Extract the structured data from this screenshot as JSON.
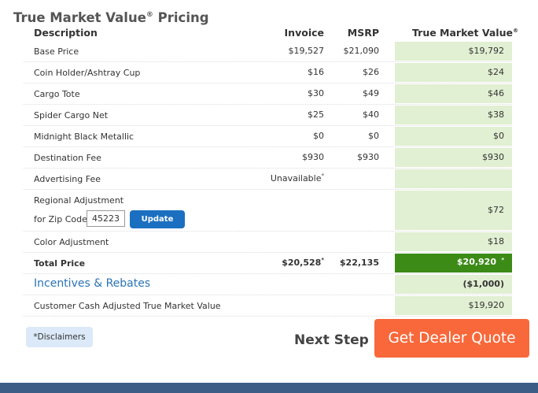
{
  "title": "True Market Value",
  "title_mark": "®",
  "columns": {
    "description": "Description",
    "invoice": "Invoice",
    "msrp": "MSRP",
    "tmv": "True Market Value",
    "tmv_mark": "®"
  },
  "rows": [
    {
      "label": "Base Price",
      "invoice": "$19,527",
      "msrp": "$21,090",
      "tmv": "$19,792"
    },
    {
      "label": "Coin Holder/Ashtray Cup",
      "invoice": "$16",
      "msrp": "$26",
      "tmv": "$24"
    },
    {
      "label": "Cargo Tote",
      "invoice": "$30",
      "msrp": "$49",
      "tmv": "$46"
    },
    {
      "label": "Spider Cargo Net",
      "invoice": "$25",
      "msrp": "$40",
      "tmv": "$38"
    },
    {
      "label": "Midnight Black Metallic",
      "invoice": "$0",
      "msrp": "$0",
      "tmv": "$0"
    },
    {
      "label": "Destination Fee",
      "invoice": "$930",
      "msrp": "$930",
      "tmv": "$930"
    },
    {
      "label": "Advertising Fee",
      "invoice": "Unavailable",
      "invoice_mark": "*",
      "msrp": "",
      "tmv": ""
    }
  ],
  "regional": {
    "label": "Regional Adjustment",
    "zip_label": "for Zip Code:",
    "zip_value": "45223",
    "update_label": "Update",
    "tmv": "$72"
  },
  "color_adjustment": {
    "label": "Color Adjustment",
    "tmv": "$18"
  },
  "pricing_title_word": "Pricing",
  "total": {
    "label": "Total Price",
    "invoice": "$20,528",
    "invoice_mark": "*",
    "msrp": "$22,135",
    "tmv": "$20,920",
    "tmv_mark": "*"
  },
  "incentives": {
    "label": "Incentives & Rebates",
    "tmv": "($1,000)"
  },
  "cash_adjusted": {
    "label": "Customer Cash Adjusted True Market Value",
    "tmv": "$19,920"
  },
  "disclaimers_label": "*Disclaimers",
  "next_step_label": "Next Step",
  "quote_button_label": "Get Dealer Quote",
  "colors": {
    "tmv_column": "#e1efd2",
    "total_highlight": "#3c8b16",
    "update_button": "#1b6fc0",
    "quote_button": "#f8683a",
    "link": "#2a74b6",
    "footer_bar": "#3c5d85"
  }
}
